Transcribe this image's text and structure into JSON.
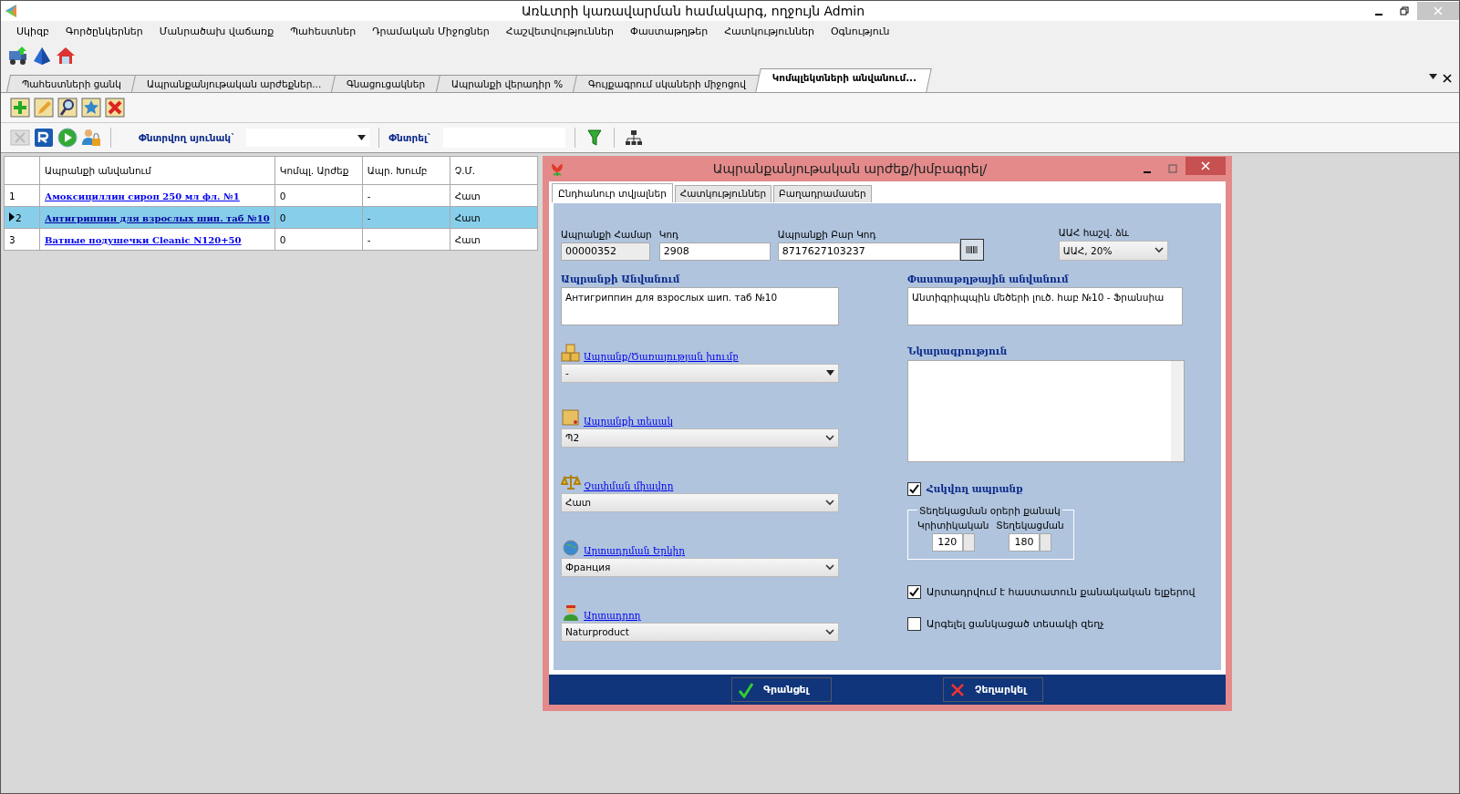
{
  "window": {
    "title": "Առևտրի կառավարման համակարգ, ողջույն Admin"
  },
  "menu": [
    "Սկիզբ",
    "Գործընկերներ",
    "Մանրածախ վաճառք",
    "Պահեստներ",
    "Դրամական Միջոցներ",
    "Հաշվետվություններ",
    "Փաստաթղթեր",
    "Հատկություններ",
    "Օգնություն"
  ],
  "doc_tabs": [
    {
      "label": "Պահեստների ցանկ",
      "selected": false
    },
    {
      "label": "Ապրանքանյութական արժեքներ...",
      "selected": false
    },
    {
      "label": "Գնացուցակներ",
      "selected": false
    },
    {
      "label": "Ապրանքի վերադիր %",
      "selected": false
    },
    {
      "label": "Գույքագրում սկաների միջոցով",
      "selected": false
    },
    {
      "label": "Կոմպլեկտների անվանում...",
      "selected": true
    }
  ],
  "toolbar": {
    "search_column_label": "Փնտրվող սյունակ`",
    "search_label": "Փնտրել`"
  },
  "table": {
    "columns": [
      "Ապրանքի անվանում",
      "Կոմպլ. Արժեք",
      "Ապր. Խումբ",
      "Չ.Մ."
    ],
    "rows": [
      {
        "number": "1",
        "name": "Амоксициллин сироп 250 мл фл. №1",
        "cost": "0",
        "group": "-",
        "unit": "Հատ",
        "selected": false
      },
      {
        "number": "2",
        "name": "Антигриппин для взрослых шип. таб №10",
        "cost": "0",
        "group": "-",
        "unit": "Հատ",
        "selected": true
      },
      {
        "number": "3",
        "name": "Ватные подушечки Cleanic N120+50",
        "cost": "0",
        "group": "-",
        "unit": "Հատ",
        "selected": false
      }
    ]
  },
  "dialog": {
    "title": "Ապրանքանյութական արժեք/խմբագրել/",
    "tabs": [
      {
        "label": "Ընդհանուր տվյալներ",
        "selected": true
      },
      {
        "label": "Հատկություններ",
        "selected": false
      },
      {
        "label": "Բաղադրամասեր",
        "selected": false
      }
    ],
    "fields": [
      {
        "label": "Ապրանքի Համար",
        "value": "00000352",
        "disabled": true
      },
      {
        "label": "Կոդ",
        "value": "2908",
        "disabled": false
      },
      {
        "label": "Ապրանքի Բար Կոդ",
        "value": "8717627103237",
        "disabled": false
      }
    ],
    "vat": {
      "label": "ԱԱՀ հաշվ. ձև",
      "value": "ԱԱՀ, 20%"
    },
    "name": {
      "label": "Ապրանքի Անվանում",
      "value": "Антигриппин для взрослых шип. таб №10"
    },
    "doc_name": {
      "label": "Փաստաթղթային անվանում",
      "value": "Անտիգրիպպին մեծերի լուծ. հաբ №10 - Ֆրանսիա"
    },
    "selects": [
      {
        "kind": "boxes",
        "label": "Ապրանք/Ծառայության խումբ",
        "value": "-"
      },
      {
        "kind": "box",
        "label": "Ապրանքի տեսակ",
        "value": "Պ2"
      },
      {
        "kind": "scales",
        "label": "Չափման միավոր",
        "value": "Հատ"
      },
      {
        "kind": "globe",
        "label": "Արտադրման Երկիր",
        "value": "Франция"
      },
      {
        "kind": "person",
        "label": "Արտադրող",
        "value": "Naturproduct"
      }
    ],
    "description": {
      "label": "Նկարագրություն"
    },
    "controlled": {
      "label": "Հսկվող ապրանք",
      "checked": true
    },
    "notify": {
      "title": "Տեղեկացման օրերի քանակ",
      "fields": [
        {
          "label": "Կրիտիկական",
          "value": "120"
        },
        {
          "label": "Տեղեկացման",
          "value": "180"
        }
      ]
    },
    "checks": [
      {
        "label": "Արտադրվում է հաստատուն քանակական ելքերով",
        "checked": true
      },
      {
        "label": "Արգելել ցանկացած տեսակի զեղչ",
        "checked": false
      }
    ],
    "buttons": [
      {
        "kind": "ok",
        "label": "Գրանցել"
      },
      {
        "kind": "cancel",
        "label": "Չեղարկել"
      }
    ]
  }
}
